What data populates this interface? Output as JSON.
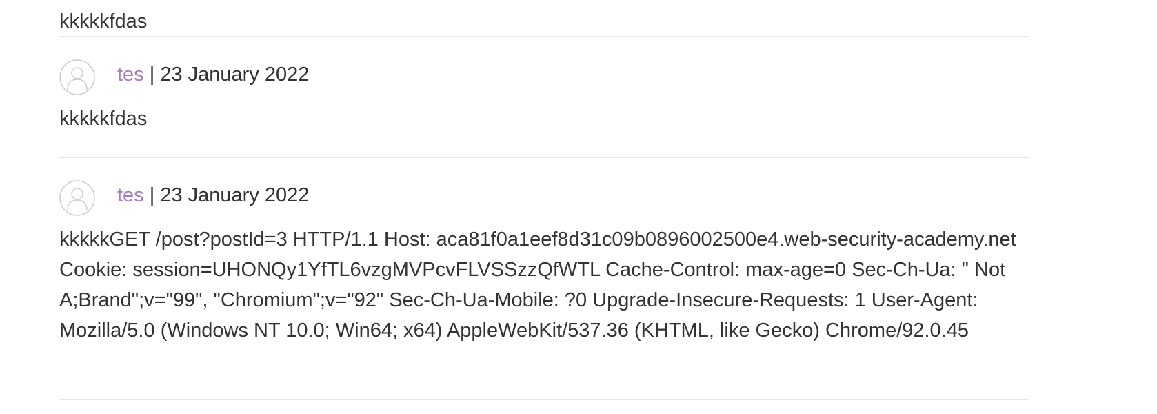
{
  "previous_comment": {
    "text": "kkkkkfdas"
  },
  "comments": [
    {
      "author": "tes",
      "separator": "|",
      "date": "23 January 2022",
      "text": "kkkkkfdas"
    },
    {
      "author": "tes",
      "separator": "|",
      "date": "23 January 2022",
      "text": "kkkkkGET /post?postId=3 HTTP/1.1 Host: aca81f0a1eef8d31c09b0896002500e4.web-security-academy.net Cookie: session=UHONQy1YfTL6vzgMVPcvFLVSSzzQfWTL Cache-Control: max-age=0 Sec-Ch-Ua: \" Not A;Brand\";v=\"99\", \"Chromium\";v=\"92\" Sec-Ch-Ua-Mobile: ?0 Upgrade-Insecure-Requests: 1 User-Agent: Mozilla/5.0 (Windows NT 10.0; Win64; x64) AppleWebKit/537.36 (KHTML, like Gecko) Chrome/92.0.45"
    }
  ],
  "icons": {
    "avatar": "user-avatar-icon"
  },
  "colors": {
    "author_link": "#a57fbc",
    "text": "#333333",
    "divider": "#e8e8e8",
    "avatar_stroke": "#cccccc"
  }
}
